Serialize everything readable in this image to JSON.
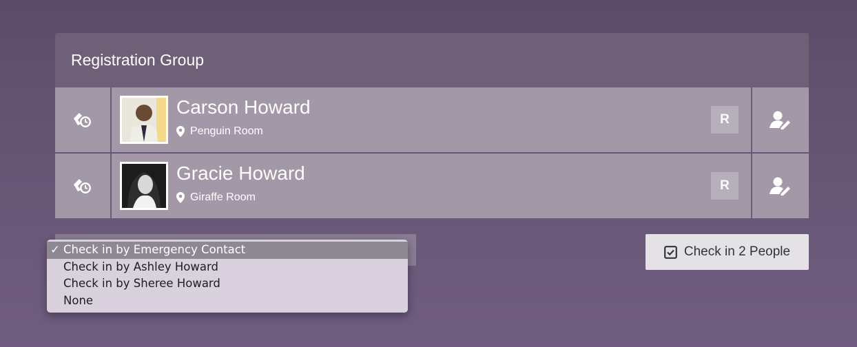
{
  "panel": {
    "title": "Registration Group"
  },
  "people": [
    {
      "name": "Carson Howard",
      "room": "Penguin Room",
      "badge": "R"
    },
    {
      "name": "Gracie Howard",
      "room": "Giraffe Room",
      "badge": "R"
    }
  ],
  "dropdown": {
    "options": [
      {
        "label": "Check in by Emergency Contact",
        "check": "✓"
      },
      {
        "label": "Check in by Ashley Howard"
      },
      {
        "label": "Check in by Sheree Howard"
      },
      {
        "label": "None"
      }
    ]
  },
  "checkin_button": {
    "label": "Check in 2 People"
  },
  "icons": {
    "row_left": "scale-clock-icon",
    "row_right": "edit-person-icon",
    "room": "map-pin-icon",
    "checkin": "checkbox-checked-icon"
  }
}
